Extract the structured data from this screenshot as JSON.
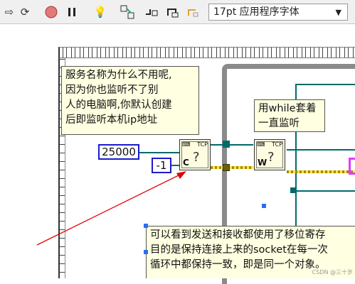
{
  "toolbar": {
    "icons": [
      "run-arrow-icon",
      "run-continuously-icon",
      "abort-icon",
      "pause-icon",
      "highlight-bulb-icon",
      "retain-wire-values-icon",
      "step-into-icon",
      "step-over-icon",
      "step-out-icon"
    ],
    "font_select": "17pt 应用程序字体"
  },
  "diagram": {
    "comment_top_left": "服务名称为什么不用呢,\n因为你也监听不了别\n人的电脑啊,你默认创建\n后即监听本机ip地址",
    "comment_while": "用while套着\n一直监听",
    "comment_bottom": "可以看到发送和接收都使用了移位寄存\n目的是保持连接上来的socket在每一次\n循环中都保持一致，即是同一个对象。\n",
    "const_port": "25000",
    "const_timeout": "-1",
    "vi_create": {
      "title": "TCP",
      "letter": "C"
    },
    "vi_wait": {
      "title": "TCP",
      "letter": "W"
    },
    "watermark": "CSDN @三十岁"
  },
  "colors": {
    "comment_bg": "#ffffe1",
    "wire_teal": "#006a6a",
    "arrow_red": "#e00000",
    "loop_border": "#8a8a8a",
    "constant_border": "#1a1acc"
  }
}
